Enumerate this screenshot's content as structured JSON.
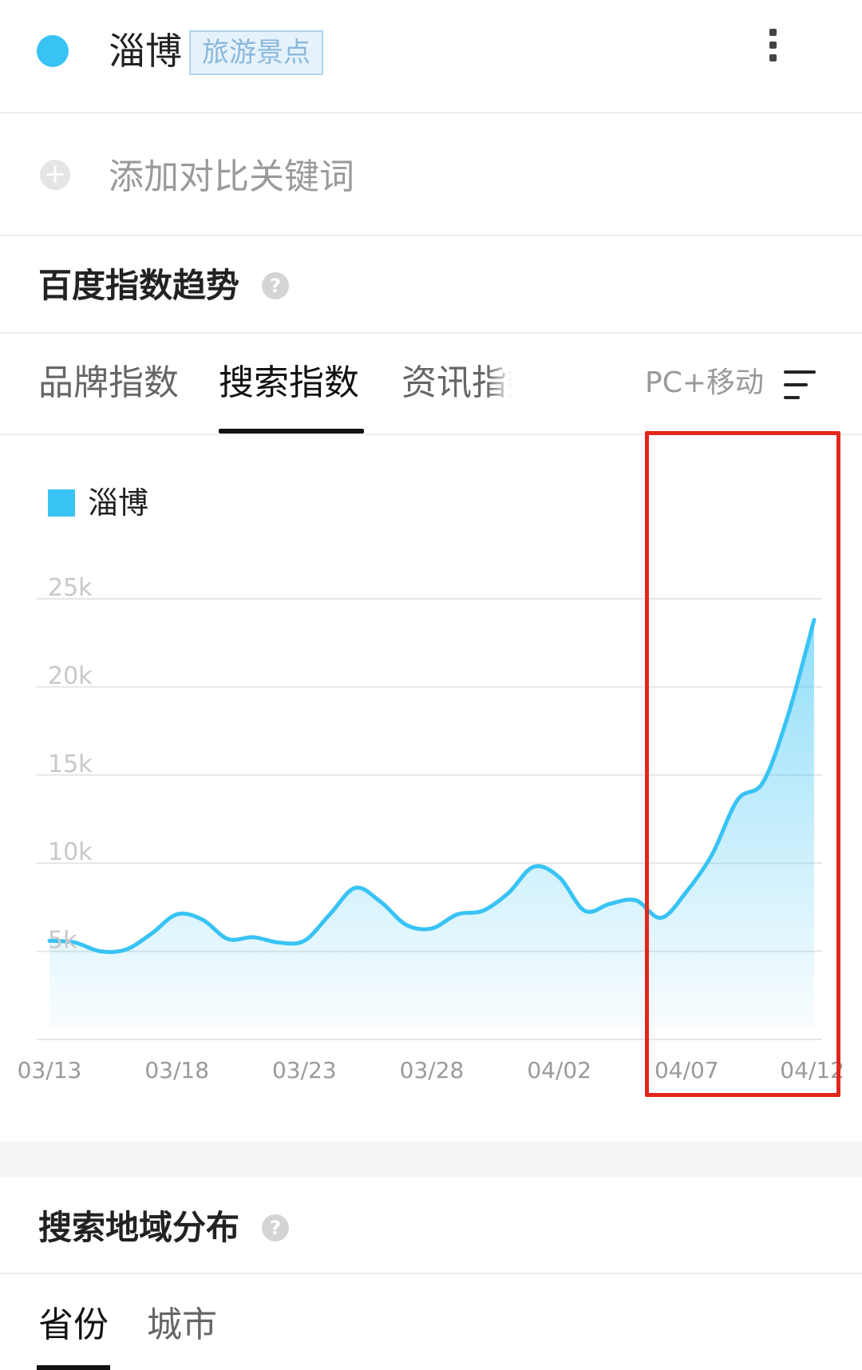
{
  "keyword": {
    "name": "淄博",
    "tag": "旅游景点",
    "color": "#38c3f4"
  },
  "add_compare": {
    "plus": "+",
    "label": "添加对比关键词"
  },
  "trend_section": {
    "title": "百度指数趋势",
    "help": "?"
  },
  "tabs": [
    {
      "label": "品牌指数",
      "active": false
    },
    {
      "label": "搜索指数",
      "active": true
    },
    {
      "label": "资讯指数",
      "active": false
    }
  ],
  "device_filter": "PC+移动",
  "colors": {
    "accent": "#38c3f4",
    "highlight": "#e3261c",
    "grid": "#e6e6e6",
    "axis_text": "#9a9a9a"
  },
  "chart_data": {
    "type": "area",
    "title": "",
    "xlabel": "",
    "ylabel": "",
    "legend": {
      "position": "top-left"
    },
    "grid": true,
    "ylim": [
      0,
      25000
    ],
    "y_ticks": [
      {
        "value": 5000,
        "label": "5k"
      },
      {
        "value": 10000,
        "label": "10k"
      },
      {
        "value": 15000,
        "label": "15k"
      },
      {
        "value": 20000,
        "label": "20k"
      },
      {
        "value": 25000,
        "label": "25k"
      }
    ],
    "x_ticks": [
      "03/13",
      "03/18",
      "03/23",
      "03/28",
      "04/02",
      "04/07",
      "04/12"
    ],
    "x": [
      "03/13",
      "03/14",
      "03/15",
      "03/16",
      "03/17",
      "03/18",
      "03/19",
      "03/20",
      "03/21",
      "03/22",
      "03/23",
      "03/24",
      "03/25",
      "03/26",
      "03/27",
      "03/28",
      "03/29",
      "03/30",
      "03/31",
      "04/01",
      "04/02",
      "04/03",
      "04/04",
      "04/05",
      "04/06",
      "04/07",
      "04/08",
      "04/09",
      "04/10",
      "04/11",
      "04/12"
    ],
    "series": [
      {
        "name": "淄博",
        "color": "#38c3f4",
        "values": [
          5600,
          5500,
          5000,
          5100,
          6000,
          7100,
          6800,
          5700,
          5800,
          5500,
          5600,
          7100,
          8600,
          7800,
          6500,
          6300,
          7100,
          7300,
          8300,
          9800,
          9200,
          7300,
          7700,
          7900,
          6900,
          8400,
          10500,
          13600,
          14600,
          18500,
          23800
        ]
      }
    ],
    "highlight_range": [
      "04/07",
      "04/12"
    ]
  },
  "region_section": {
    "title": "搜索地域分布",
    "help": "?",
    "tabs": [
      {
        "label": "省份",
        "active": true
      },
      {
        "label": "城市",
        "active": false
      }
    ]
  }
}
